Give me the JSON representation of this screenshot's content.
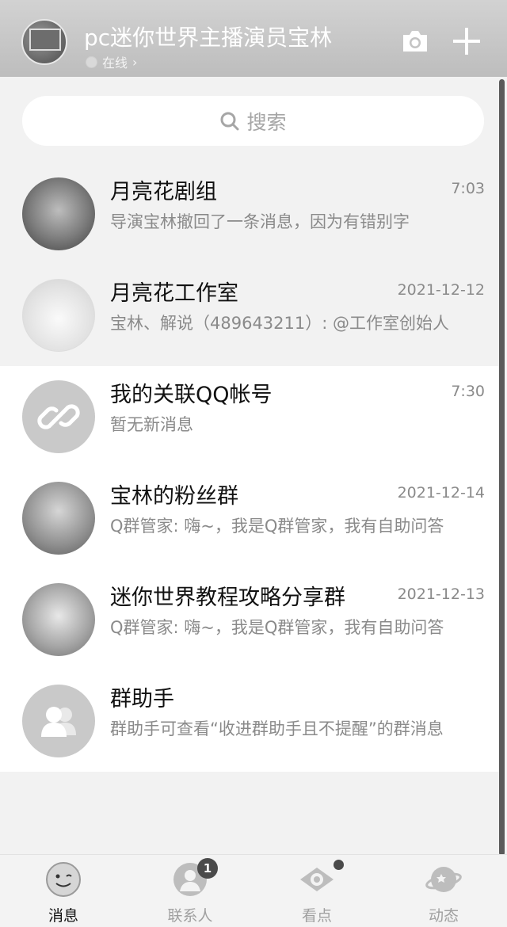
{
  "header": {
    "title": "pc迷你世界主播演员宝林",
    "status": "在线",
    "status_arrow": "›"
  },
  "search": {
    "placeholder": "搜索"
  },
  "conversations": [
    {
      "name": "月亮花剧组",
      "time": "7:03",
      "message": "导演宝林撤回了一条消息，因为有错别字"
    },
    {
      "name": "月亮花工作室",
      "time": "2021-12-12",
      "message": "宝林、解说（489643211）: @工作室创始人"
    },
    {
      "name": "我的关联QQ帐号",
      "time": "7:30",
      "message": "暂无新消息"
    },
    {
      "name": "宝林的粉丝群",
      "time": "2021-12-14",
      "message": "Q群管家: 嗨~，我是Q群管家，我有自助问答"
    },
    {
      "name": "迷你世界教程攻略分享群",
      "time": "2021-12-13",
      "message": "Q群管家: 嗨~，我是Q群管家，我有自助问答"
    },
    {
      "name": "群助手",
      "time": "",
      "message": "群助手可查看“收进群助手且不提醒”的群消息"
    }
  ],
  "tabs": [
    {
      "label": "消息",
      "icon": "message-face-icon",
      "active": true
    },
    {
      "label": "联系人",
      "icon": "contacts-icon",
      "badge": "1"
    },
    {
      "label": "看点",
      "icon": "eye-icon",
      "dot": true
    },
    {
      "label": "动态",
      "icon": "planet-icon"
    }
  ],
  "colors": {
    "header_bg": "#c6c6c6",
    "badge": "#4a4a4a",
    "muted_text": "#8a8a8a"
  }
}
